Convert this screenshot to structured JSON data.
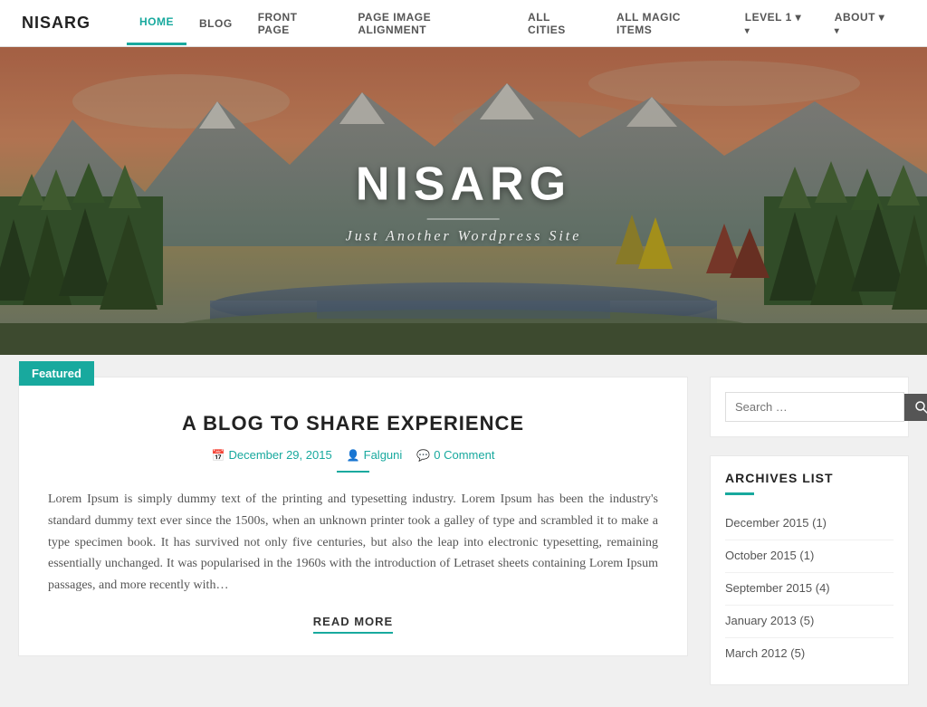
{
  "brand": "NISARG",
  "nav": {
    "items": [
      {
        "label": "HOME",
        "active": true,
        "has_arrow": false
      },
      {
        "label": "BLOG",
        "active": false,
        "has_arrow": false
      },
      {
        "label": "FRONT PAGE",
        "active": false,
        "has_arrow": false
      },
      {
        "label": "PAGE IMAGE ALIGNMENT",
        "active": false,
        "has_arrow": false
      },
      {
        "label": "ALL CITIES",
        "active": false,
        "has_arrow": false
      },
      {
        "label": "ALL MAGIC ITEMS",
        "active": false,
        "has_arrow": false
      },
      {
        "label": "LEVEL 1",
        "active": false,
        "has_arrow": true
      },
      {
        "label": "ABOUT",
        "active": false,
        "has_arrow": true
      }
    ]
  },
  "hero": {
    "title": "NISARG",
    "subtitle": "Just Another Wordpress Site"
  },
  "post": {
    "featured_label": "Featured",
    "title": "A BLOG TO SHARE EXPERIENCE",
    "date": "December 29, 2015",
    "author": "Falguni",
    "comments": "0 Comment",
    "excerpt": "Lorem Ipsum is simply dummy text of the printing and typesetting industry. Lorem Ipsum has been the industry's standard dummy text ever since the 1500s, when an unknown printer took a galley of type and scrambled it to make a type specimen book. It has survived not only five centuries, but also the leap into electronic typesetting, remaining essentially unchanged. It was popularised in the 1960s with the introduction of Letraset sheets containing Lorem Ipsum passages, and more recently with…",
    "read_more": "READ MORE"
  },
  "sidebar": {
    "search_placeholder": "Search …",
    "archives_title": "ARCHIVES LIST",
    "archives": [
      {
        "label": "December 2015 (1)"
      },
      {
        "label": "October 2015 (1)"
      },
      {
        "label": "September 2015 (4)"
      },
      {
        "label": "January 2013 (5)"
      },
      {
        "label": "March 2012 (5)"
      }
    ]
  }
}
